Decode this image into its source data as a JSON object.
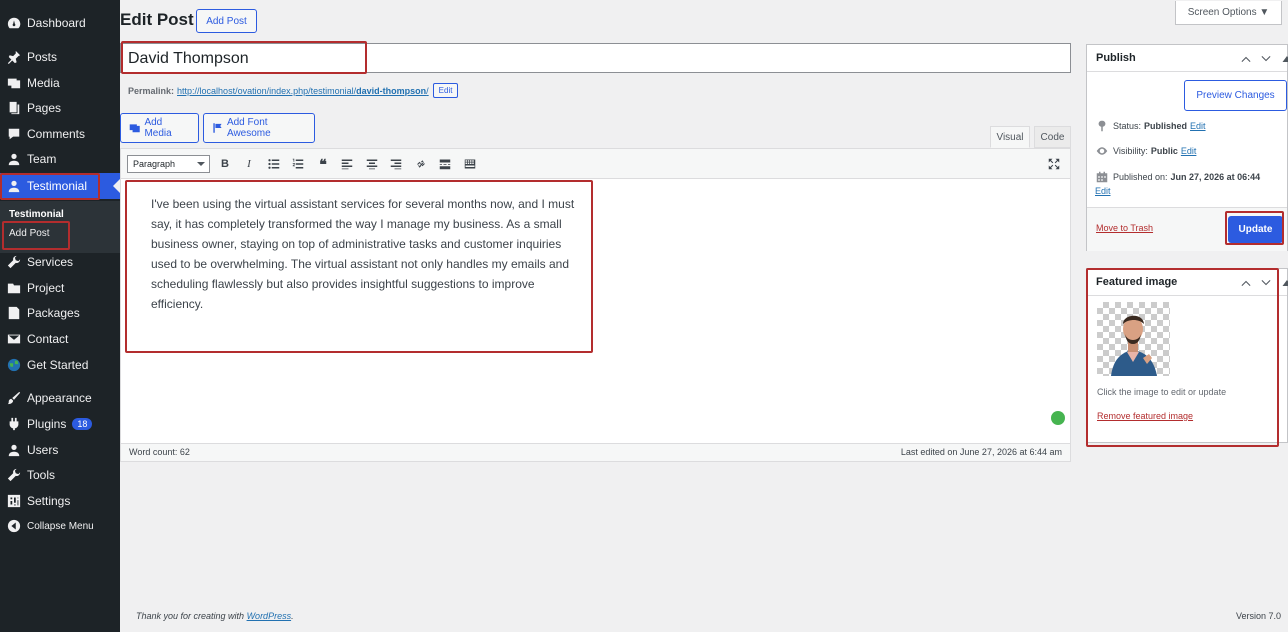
{
  "sidebar": {
    "items": [
      {
        "label": "Dashboard",
        "icon": "dashboard-icon"
      },
      {
        "label": "Posts",
        "icon": "pin-icon"
      },
      {
        "label": "Media",
        "icon": "media-icon"
      },
      {
        "label": "Pages",
        "icon": "pages-icon"
      },
      {
        "label": "Comments",
        "icon": "comments-icon"
      },
      {
        "label": "Team",
        "icon": "user-icon"
      },
      {
        "label": "Testimonial",
        "icon": "user-icon"
      },
      {
        "label": "Services",
        "icon": "wrench-icon"
      },
      {
        "label": "Project",
        "icon": "folder-icon"
      },
      {
        "label": "Packages",
        "icon": "document-icon"
      },
      {
        "label": "Contact",
        "icon": "mail-icon"
      },
      {
        "label": "Get Started",
        "icon": "globe-icon"
      },
      {
        "label": "Appearance",
        "icon": "brush-icon"
      },
      {
        "label": "Plugins",
        "icon": "plugin-icon",
        "badge": "18"
      },
      {
        "label": "Users",
        "icon": "user-icon"
      },
      {
        "label": "Tools",
        "icon": "wrench-icon"
      },
      {
        "label": "Settings",
        "icon": "settings-icon"
      },
      {
        "label": "Collapse Menu",
        "icon": "collapse-icon"
      }
    ],
    "submenu": {
      "title": "Testimonial",
      "item": "Add Post"
    }
  },
  "header": {
    "title": "Edit Post",
    "add_post": "Add Post",
    "screen_options": "Screen Options ▼"
  },
  "post": {
    "title": "David Thompson",
    "permalink_label": "Permalink:",
    "permalink_base": "http://localhost/ovation/index.php/testimonial/",
    "permalink_slug": "david-thompson",
    "permalink_end": "/",
    "edit": "Edit"
  },
  "editor": {
    "add_media": "Add Media",
    "add_font_awesome": "Add Font Awesome",
    "tab_visual": "Visual",
    "tab_code": "Code",
    "format": "Paragraph",
    "content": "I've been using the virtual assistant services for several months now, and I must say, it has completely transformed the way I manage my business. As a small business owner, staying on top of administrative tasks and customer inquiries used to be overwhelming. The virtual assistant not only handles my emails and scheduling flawlessly but also provides insightful suggestions to improve efficiency.",
    "word_count": "Word count: 62",
    "last_edited": "Last edited on June 27, 2026 at 6:44 am"
  },
  "publish": {
    "title": "Publish",
    "preview": "Preview Changes",
    "status_label": "Status:",
    "status_value": "Published",
    "visibility_label": "Visibility:",
    "visibility_value": "Public",
    "published_label": "Published on:",
    "published_value": "Jun 27, 2026 at 06:44",
    "edit": "Edit",
    "trash": "Move to Trash",
    "update": "Update"
  },
  "featured": {
    "title": "Featured image",
    "help": "Click the image to edit or update",
    "remove": "Remove featured image"
  },
  "footer": {
    "thanks_prefix": "Thank you for creating with ",
    "thanks_link": "WordPress",
    "thanks_suffix": ".",
    "version": "Version 7.0"
  },
  "colors": {
    "accent": "#2c5be0",
    "highlight": "#b32d2e",
    "menu_bg": "#1d2327"
  }
}
